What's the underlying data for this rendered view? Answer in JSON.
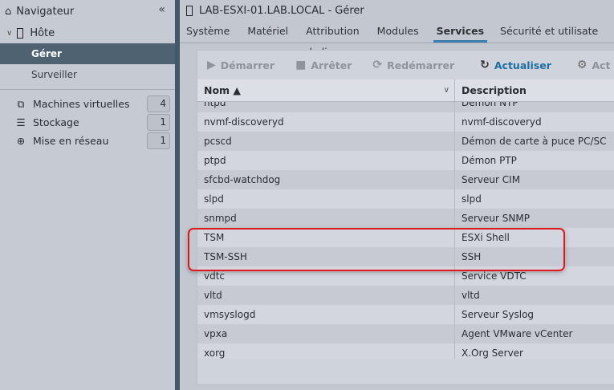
{
  "sidebar": {
    "title": "Navigateur",
    "host": "Hôte",
    "items": [
      {
        "label": "Gérer",
        "selected": true
      },
      {
        "label": "Surveiller",
        "selected": false
      }
    ],
    "inventory": [
      {
        "label": "Machines virtuelles",
        "count": "4",
        "icon": "vm-icon"
      },
      {
        "label": "Stockage",
        "count": "1",
        "icon": "storage-icon"
      },
      {
        "label": "Mise en réseau",
        "count": "1",
        "icon": "network-icon"
      }
    ]
  },
  "header": {
    "title": "LAB-ESXI-01.LAB.LOCAL - Gérer"
  },
  "tabs": [
    {
      "label": "Système"
    },
    {
      "label": "Matériel"
    },
    {
      "label": "Attribution de licence"
    },
    {
      "label": "Modules"
    },
    {
      "label": "Services",
      "active": true
    },
    {
      "label": "Sécurité et utilisate"
    }
  ],
  "toolbar": {
    "start": "Démarrer",
    "stop": "Arrêter",
    "restart": "Redémarrer",
    "refresh": "Actualiser",
    "actions": "Act"
  },
  "table": {
    "columns": [
      "Nom ▲",
      "Description"
    ],
    "rows": [
      [
        "ntpd",
        "Démon NTP"
      ],
      [
        "nvmf-discoveryd",
        "nvmf-discoveryd"
      ],
      [
        "pcscd",
        "Démon de carte à puce PC/SC"
      ],
      [
        "ptpd",
        "Démon PTP"
      ],
      [
        "sfcbd-watchdog",
        "Serveur CIM"
      ],
      [
        "slpd",
        "slpd"
      ],
      [
        "snmpd",
        "Serveur SNMP"
      ],
      [
        "TSM",
        "ESXi Shell"
      ],
      [
        "TSM-SSH",
        "SSH"
      ],
      [
        "vdtc",
        "Service VDTC"
      ],
      [
        "vltd",
        "vltd"
      ],
      [
        "vmsyslogd",
        "Serveur Syslog"
      ],
      [
        "vpxa",
        "Agent VMware vCenter"
      ],
      [
        "xorg",
        "X.Org Server"
      ]
    ]
  },
  "colors": {
    "selected": "#4e6272",
    "accent": "#1d6fa3",
    "highlight": "#e0181c"
  }
}
